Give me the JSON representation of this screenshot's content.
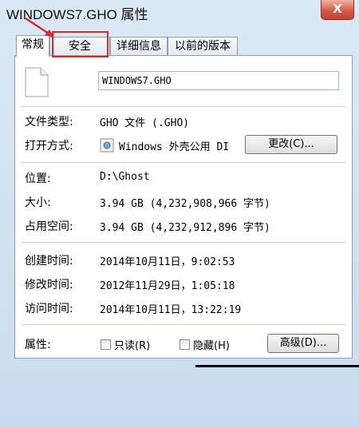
{
  "window": {
    "title": "WINDOWS7.GHO 属性",
    "close_label": "X"
  },
  "tabs": [
    {
      "label": "常规",
      "active": true
    },
    {
      "label": "安全",
      "active": false
    },
    {
      "label": "详细信息",
      "active": false
    },
    {
      "label": "以前的版本",
      "active": false
    }
  ],
  "general": {
    "file_name": "WINDOWS7.GHO",
    "file_type_label": "文件类型:",
    "file_type_value": "GHO 文件 (.GHO)",
    "open_with_label": "打开方式:",
    "open_with_value": "Windows 外壳公用 DI",
    "change_button": "更改(C)...",
    "location_label": "位置:",
    "location_value": "D:\\Ghost",
    "size_label": "大小:",
    "size_value": "3.94 GB (4,232,908,966 字节)",
    "size_on_disk_label": "占用空间:",
    "size_on_disk_value": "3.94 GB (4,232,912,896 字节)",
    "created_label": "创建时间:",
    "created_value": "2014年10月11日，9:02:53",
    "modified_label": "修改时间:",
    "modified_value": "2012年11月29日，1:05:18",
    "accessed_label": "访问时间:",
    "accessed_value": "2014年10月11日，13:22:19",
    "attributes_label": "属性:",
    "readonly_label": "只读(R)",
    "readonly_checked": false,
    "hidden_label": "隐藏(H)",
    "hidden_checked": false,
    "advanced_button": "高级(D)..."
  },
  "colors": {
    "highlight_box": "#d42a2a",
    "window_bg": "#c9dcef"
  }
}
